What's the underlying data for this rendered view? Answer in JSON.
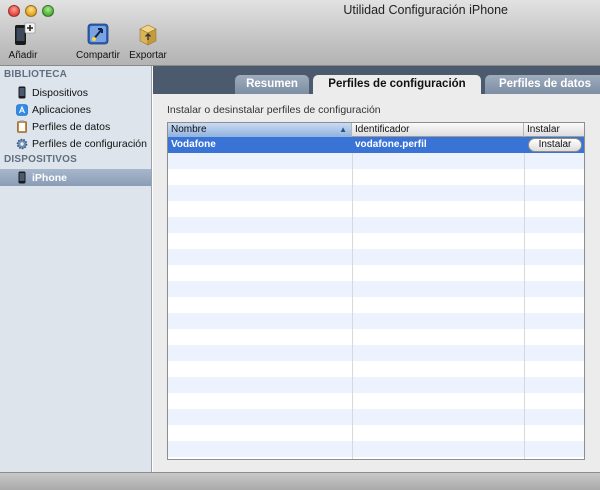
{
  "window": {
    "title": "Utilidad Configuración iPhone"
  },
  "toolbar": {
    "add_label": "Añadir",
    "share_label": "Compartir",
    "export_label": "Exportar"
  },
  "sidebar": {
    "library_header": "BIBLIOTECA",
    "library_items": [
      {
        "label": "Dispositivos",
        "icon": "iphone-icon"
      },
      {
        "label": "Aplicaciones",
        "icon": "app-store-icon"
      },
      {
        "label": "Perfiles de datos",
        "icon": "clipboard-icon"
      },
      {
        "label": "Perfiles de configuración",
        "icon": "gear-icon"
      }
    ],
    "devices_header": "DISPOSITIVOS",
    "device_items": [
      {
        "label": "iPhone",
        "icon": "iphone-icon",
        "selected": true
      }
    ]
  },
  "tabs": [
    {
      "label": "Resumen",
      "active": false
    },
    {
      "label": "Perfiles de configuración",
      "active": true
    },
    {
      "label": "Perfiles de datos",
      "active": false
    }
  ],
  "content": {
    "instruction": "Instalar o desinstalar perfiles de configuración",
    "table": {
      "columns": [
        "Nombre",
        "Identificador",
        "Instalar"
      ],
      "sort_column": "Nombre",
      "sort_direction": "ascending",
      "rows": [
        {
          "name": "Vodafone",
          "identifier": "vodafone.perfil",
          "action": "Instalar",
          "selected": true
        }
      ]
    }
  },
  "colors": {
    "selection": "#3a73d6",
    "tab_strip": "#4b5a6c",
    "sidebar_bg": "#dde4ec",
    "row_stripe": "#edf3fe"
  }
}
